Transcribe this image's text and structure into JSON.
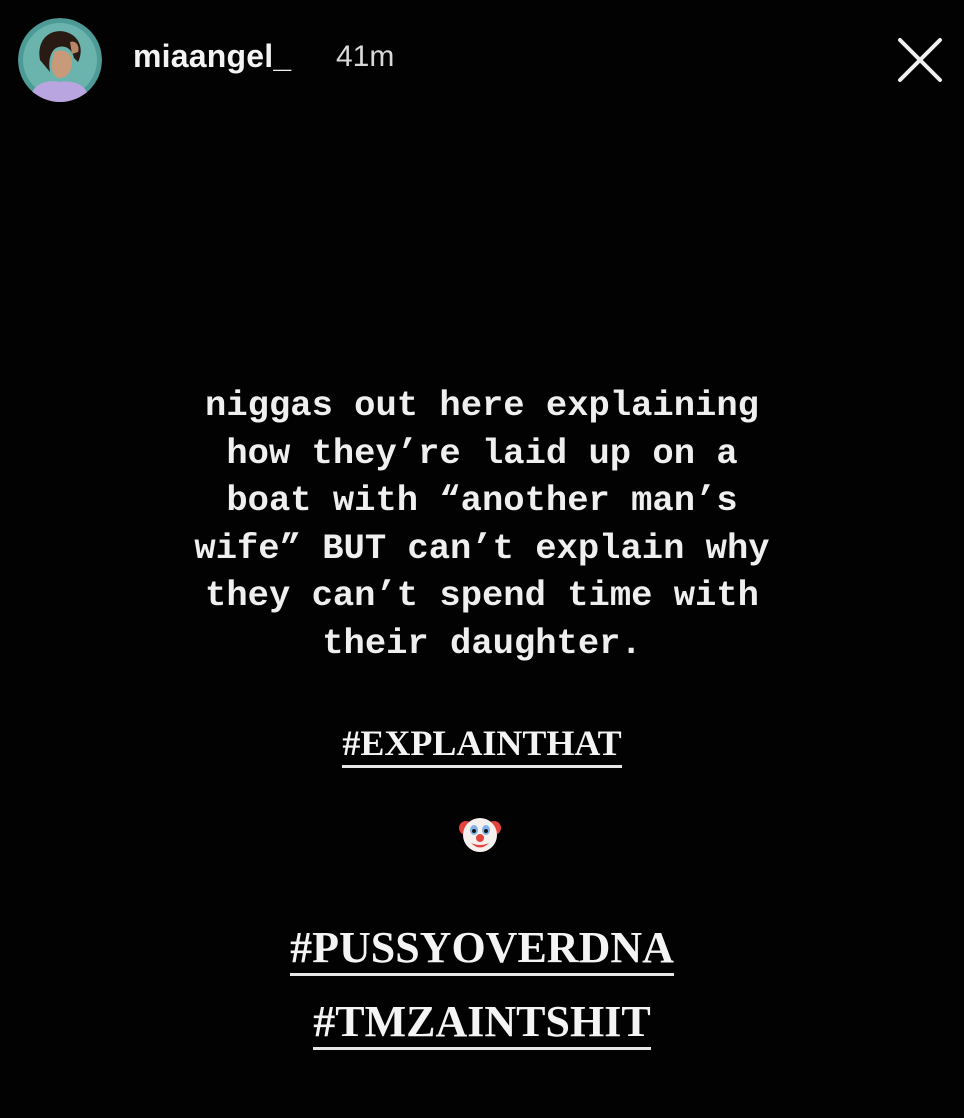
{
  "header": {
    "username": "miaangel_",
    "timestamp": "41m",
    "avatar_icon": "profile-avatar"
  },
  "story": {
    "message": "niggas out here explaining\nhow they’re laid up on a\nboat with “another man’s\nwife” BUT can’t explain why\nthey can’t spend time with\ntheir daughter.",
    "hashtag_1": "#EXPLAINTHAT",
    "emoji": "clown-face",
    "hashtag_2": "#PUSSYOVERDNA",
    "hashtag_3": "#TMZAINTSHIT"
  },
  "colors": {
    "background": "#020202",
    "text": "#f2f2f2",
    "avatar_ring": "#4d9a96"
  }
}
